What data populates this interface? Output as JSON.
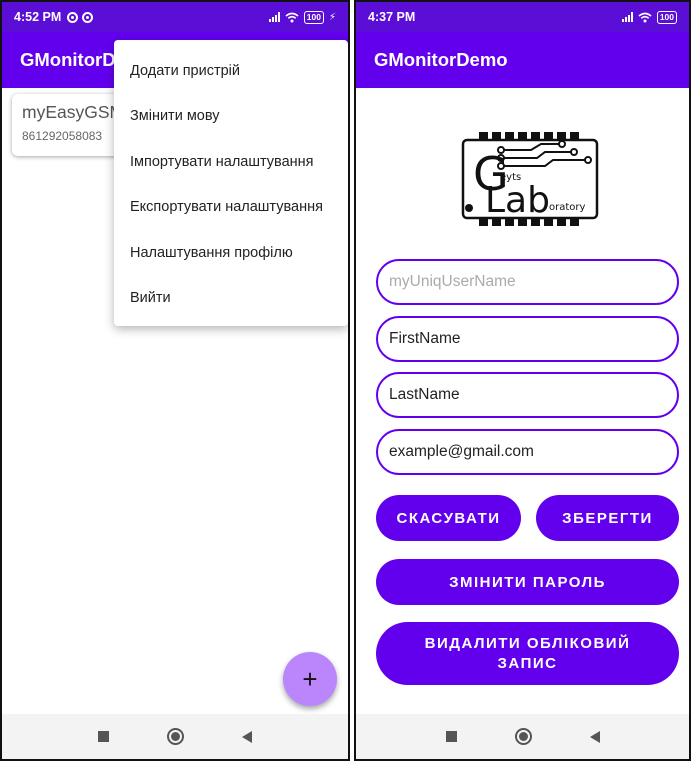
{
  "left_screen": {
    "status": {
      "time": "4:52 PM",
      "battery": "100"
    },
    "app_title": "GMonitorDemo",
    "device": {
      "name": "myEasyGSM",
      "id": "861292058083"
    },
    "menu": [
      "Додати пристрій",
      "Змінити мову",
      "Імпортувати налаштування",
      "Експортувати налаштування",
      "Налаштування профілю",
      "Вийти"
    ],
    "fab_label": "+"
  },
  "right_screen": {
    "status": {
      "time": "4:37 PM",
      "battery": "100"
    },
    "app_title": "GMonitorDemo",
    "logo": {
      "big_g": "G",
      "lab": "Lab",
      "eyts": "eyts",
      "oratory": "oratory"
    },
    "form": {
      "username_placeholder": "myUniqUserName",
      "first_name": "FirstName",
      "last_name": "LastName",
      "email": "example@gmail.com"
    },
    "buttons": {
      "cancel": "СКАСУВАТИ",
      "save": "ЗБЕРЕГТИ",
      "change_password": "ЗМІНИТИ ПАРОЛЬ",
      "delete_account": "ВИДАЛИТИ ОБЛІКОВИЙ ЗАПИС"
    }
  },
  "colors": {
    "status_bar": "#5b0fd6",
    "app_bar": "#6200ee",
    "fab": "#bb86fc",
    "field_border": "#6200ee",
    "button": "#6200ee"
  },
  "icons": [
    "dnd-icon",
    "signal-icon",
    "wifi-icon",
    "battery-icon",
    "charging-icon",
    "plus-icon",
    "nav-recents-icon",
    "nav-home-icon",
    "nav-back-icon"
  ]
}
